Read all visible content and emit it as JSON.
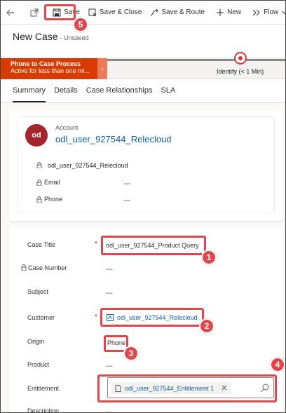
{
  "commandbar": {
    "save": "Save",
    "save_close": "Save & Close",
    "save_route": "Save & Route",
    "new": "New",
    "flow": "Flow"
  },
  "header": {
    "title": "New Case",
    "status": "- Unsaved"
  },
  "process": {
    "active_stage": "Phone to Case Process",
    "active_duration": "Active for less than one mi...",
    "next_stage": "Identify",
    "next_duration": "(< 1 Min)"
  },
  "tabs": [
    "Summary",
    "Details",
    "Case Relationships",
    "SLA"
  ],
  "account_card": {
    "avatar_initials": "od",
    "label": "Account",
    "name": "odl_user_927544_Relecloud",
    "locked_line": "odl_user_927544_Relecloud",
    "email_label": "Email",
    "email_value": "---",
    "phone_label": "Phone",
    "phone_value": "---"
  },
  "form": {
    "case_title_label": "Case Title",
    "case_title_value": "odl_user_927544_Product Query",
    "case_number_label": "Case Number",
    "case_number_value": "---",
    "subject_label": "Subject",
    "subject_value": "---",
    "customer_label": "Customer",
    "customer_value": "odl_user_927544_Relecloud",
    "origin_label": "Origin",
    "origin_value": "Phone",
    "product_label": "Product",
    "product_value": "---",
    "entitlement_label": "Entitlement",
    "entitlement_value": "odl_user_927544_Entitlement 1",
    "description_label": "Description",
    "description_value": "---",
    "required_mark": "*"
  },
  "callouts": [
    "1",
    "2",
    "3",
    "4",
    "5"
  ],
  "colors": {
    "accent_red": "#e0474c",
    "process_orange": "#d83b01",
    "link_blue": "#115ea3"
  }
}
